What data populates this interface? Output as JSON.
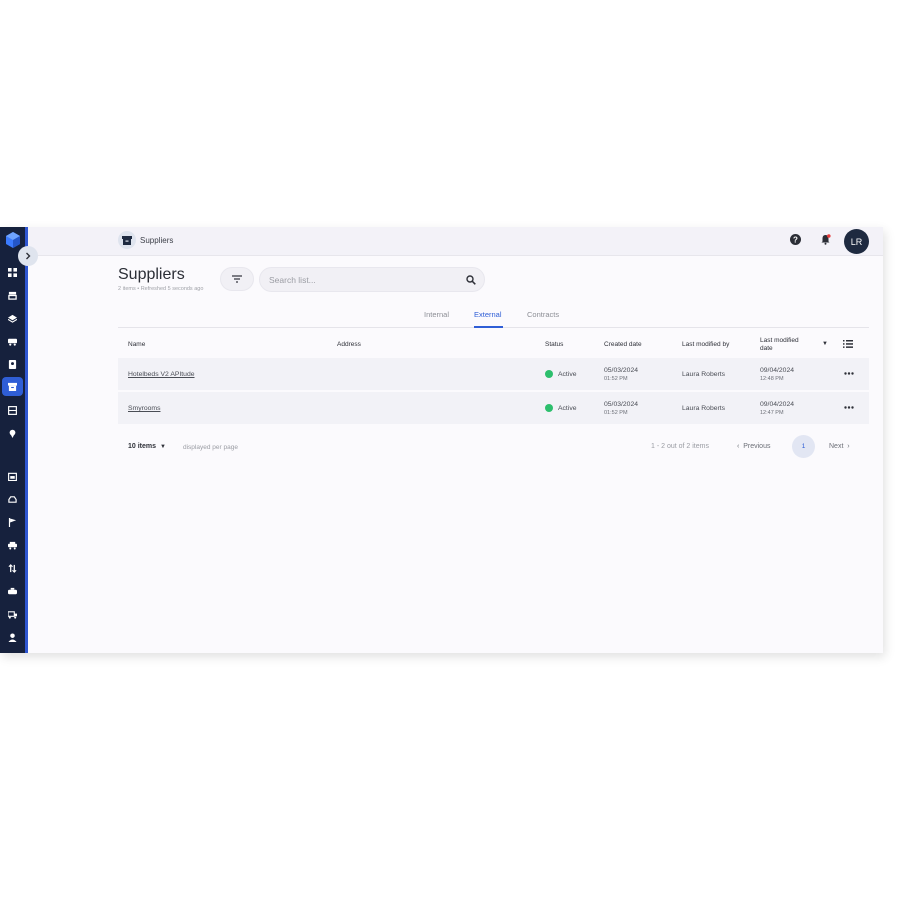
{
  "app": {
    "breadcrumb": "Suppliers",
    "avatar_initials": "LR"
  },
  "colors": {
    "accent": "#2f5ed6",
    "sidebar": "#16213d",
    "status_active": "#2dbf6d"
  },
  "icons": {
    "logo": "cube-logo-icon",
    "help": "help-icon",
    "notifications": "bell-icon",
    "filter": "filter-icon",
    "search": "search-icon",
    "columns": "list-columns-icon",
    "row_menu": "ellipsis-icon"
  },
  "sidebar": {
    "items": [
      {
        "icon": "dashboard-icon"
      },
      {
        "icon": "inventory-icon"
      },
      {
        "icon": "layers-icon"
      },
      {
        "icon": "transport-icon"
      },
      {
        "icon": "contacts-icon"
      },
      {
        "icon": "suppliers-icon",
        "active": true
      },
      {
        "icon": "table-icon"
      },
      {
        "icon": "location-icon"
      },
      {
        "icon": "calendar-icon"
      },
      {
        "icon": "car-icon"
      },
      {
        "icon": "flag-icon"
      },
      {
        "icon": "vehicle-icon"
      },
      {
        "icon": "transfer-icon"
      },
      {
        "icon": "taxi-icon"
      },
      {
        "icon": "bus-icon"
      },
      {
        "icon": "person-icon"
      }
    ]
  },
  "page": {
    "title": "Suppliers",
    "subtitle": "2 items • Refreshed 5 seconds ago"
  },
  "search": {
    "placeholder": "Search list..."
  },
  "tabs": {
    "internal": "Internal",
    "external": "External",
    "contracts": "Contracts",
    "active": "External"
  },
  "table": {
    "headers": {
      "name": "Name",
      "address": "Address",
      "status": "Status",
      "created": "Created date",
      "modified_by": "Last modified by",
      "modified_date": "Last modified date"
    },
    "rows": [
      {
        "name": "Hotelbeds V2 APItude",
        "address": "",
        "status": "Active",
        "created_date": "05/03/2024",
        "created_time": "01:52 PM",
        "modified_by": "Laura Roberts",
        "modified_date": "09/04/2024",
        "modified_time": "12:48 PM"
      },
      {
        "name": "Smyrooms",
        "address": "",
        "status": "Active",
        "created_date": "05/03/2024",
        "created_time": "01:52 PM",
        "modified_by": "Laura Roberts",
        "modified_date": "09/04/2024",
        "modified_time": "12:47 PM"
      }
    ]
  },
  "pagination": {
    "per_page": "10 items",
    "per_page_label": "displayed per page",
    "range": "1 - 2 out of 2 items",
    "previous": "Previous",
    "current_page": "1",
    "next": "Next"
  }
}
